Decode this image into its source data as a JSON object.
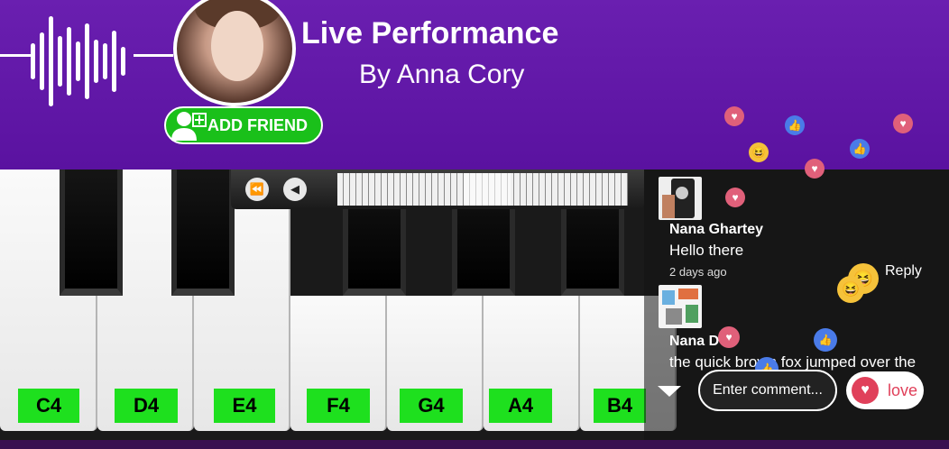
{
  "header": {
    "title": "Live Performance",
    "subtitle": "By Anna Cory",
    "add_friend_label": "ADD FRIEND",
    "bg_color": "#6a1fb0"
  },
  "piano": {
    "labels": [
      "C4",
      "D4",
      "E4",
      "F4",
      "G4",
      "A4",
      "B4"
    ]
  },
  "transport": {
    "rewind_icon": "fast-rewind-icon",
    "prev_icon": "play-back-icon"
  },
  "chat": {
    "comments": [
      {
        "name": "Nana Ghartey",
        "text": "Hello there",
        "time": "2 days ago",
        "reply": "Reply"
      },
      {
        "name": "Nana D",
        "text": "the quick brown fox jumped over the"
      }
    ],
    "input_placeholder": "Enter comment...",
    "love_label": "love"
  },
  "colors": {
    "accent_green": "#1ee01e",
    "love_red": "#e0405a",
    "like_blue": "#4a7be8"
  }
}
